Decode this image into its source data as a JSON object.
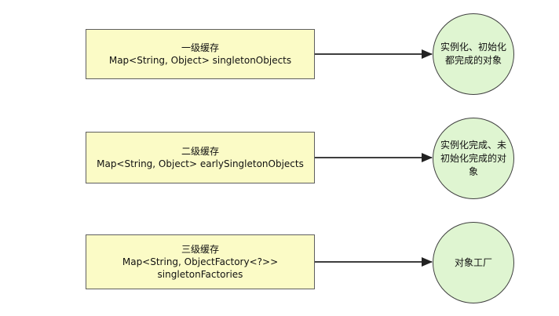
{
  "rows": [
    {
      "box_title": "一级缓存",
      "box_lines": [
        "Map<String, Object> singletonObjects"
      ],
      "circle_text": "实例化、初始化都完成的对象"
    },
    {
      "box_title": "二级缓存",
      "box_lines": [
        "Map<String, Object> earlySingletonObjects"
      ],
      "circle_text": "实例化完成、未初始化完成的对象"
    },
    {
      "box_title": "三级缓存",
      "box_lines": [
        "Map<String, ObjectFactory<?>>",
        "singletonFactories"
      ],
      "circle_text": "对象工厂"
    }
  ],
  "colors": {
    "box_fill": "#fbfbc6",
    "circle_fill": "#dff5d1",
    "stroke": "#222222"
  }
}
